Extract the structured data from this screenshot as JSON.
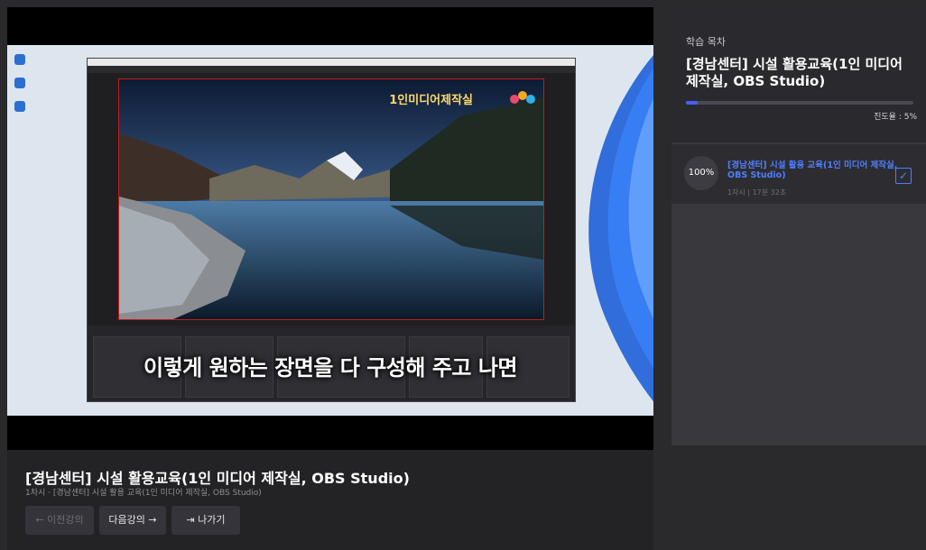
{
  "video": {
    "subtitle": "이렇게 원하는 장면을 다 구성해 주고 나면",
    "brand_text": "1인미디어제작실"
  },
  "course": {
    "title": "[경남센터] 시설 활용교육(1인 미디어 제작실, OBS Studio)",
    "subtitle": "1차시 · [경남센터] 시설 활용 교육(1인 미디어 제작실, OBS Studio)"
  },
  "nav": {
    "prev_label": "← 이전강의",
    "next_label": "다음강의 →",
    "exit_label": "나가기",
    "exit_icon": "exit-icon"
  },
  "toc": {
    "label": "학습 목차",
    "title": "[경남센터] 시설 활용교육(1인 미디어 제작실, OBS Studio)",
    "progress_percent": 5,
    "progress_text": "진도율 : 5%",
    "lesson": {
      "percent": "100%",
      "title": "[경남센터] 시설 활용 교육(1인 미디어 제작실, OBS Studio)",
      "meta": "1차시 | 17분 32초"
    }
  },
  "colors": {
    "accent": "#4f7dff",
    "progress": "#4b5cff",
    "recording_border": "#c21b1b"
  }
}
